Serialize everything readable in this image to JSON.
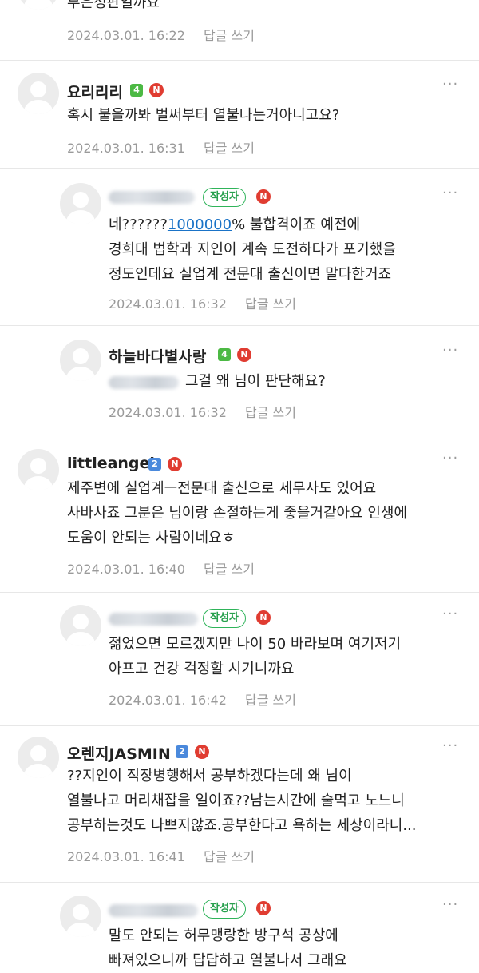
{
  "c0": {
    "text": "부은정판일까요",
    "date": "2024.03.01. 16:22",
    "reply": "답글 쓰기"
  },
  "c1": {
    "nick": "요리리리",
    "level": "4",
    "n": "N",
    "more": "···",
    "lines": [
      "혹시 붙을까봐 벌써부터 열불나는거아니고요?"
    ],
    "date": "2024.03.01. 16:31",
    "reply": "답글 쓰기"
  },
  "c2": {
    "badge": "작성자",
    "n": "N",
    "more": "···",
    "line1_a": "네??????",
    "line1_link": "1000000",
    "line1_b": "% 불합격이죠 예전에",
    "lines": [
      "경희대 법학과 지인이 계속 도전하다가 포기했을",
      "정도인데요 실업계 전문대 출신이면 말다한거죠"
    ],
    "date": "2024.03.01. 16:32",
    "reply": "답글 쓰기"
  },
  "c3": {
    "nick": "하늘바다별사랑",
    "level": "4",
    "n": "N",
    "more": "···",
    "text": "그걸 왜 님이 판단해요?",
    "date": "2024.03.01. 16:32",
    "reply": "답글 쓰기"
  },
  "c4": {
    "nick": "littleangel",
    "level": "2",
    "n": "N",
    "more": "···",
    "lines": [
      "제주변에 실업계ㅡ전문대 출신으로 세무사도 있어요",
      "사바사죠 그분은 님이랑 손절하는게 좋을거같아요 인생에",
      "도움이 안되는 사람이네요ㅎ"
    ],
    "date": "2024.03.01. 16:40",
    "reply": "답글 쓰기"
  },
  "c5": {
    "badge": "작성자",
    "n": "N",
    "more": "···",
    "lines": [
      "젊었으면 모르겠지만 나이 50 바라보며 여기저기",
      "아프고 건강 걱정할 시기니까요"
    ],
    "date": "2024.03.01. 16:42",
    "reply": "답글 쓰기"
  },
  "c6": {
    "nick": "오렌지JASMIN",
    "level": "2",
    "n": "N",
    "more": "···",
    "lines": [
      "??지인이 직장병행해서 공부하겠다는데 왜 님이",
      "열불나고 머리채잡을 일이죠??남는시간에 술먹고 노느니",
      "공부하는것도 나쁘지않죠.공부한다고 욕하는 세상이라니..."
    ],
    "date": "2024.03.01. 16:41",
    "reply": "답글 쓰기"
  },
  "c7": {
    "badge": "작성자",
    "n": "N",
    "more": "···",
    "lines": [
      "말도 안되는 허무맹랑한 방구석 공상에",
      "빠져있으니까 답답하고 열불나서 그래요"
    ]
  },
  "colors": {
    "author_green": "#2fb45a",
    "n_red": "#e03c31",
    "link_blue": "#1a73c7"
  }
}
